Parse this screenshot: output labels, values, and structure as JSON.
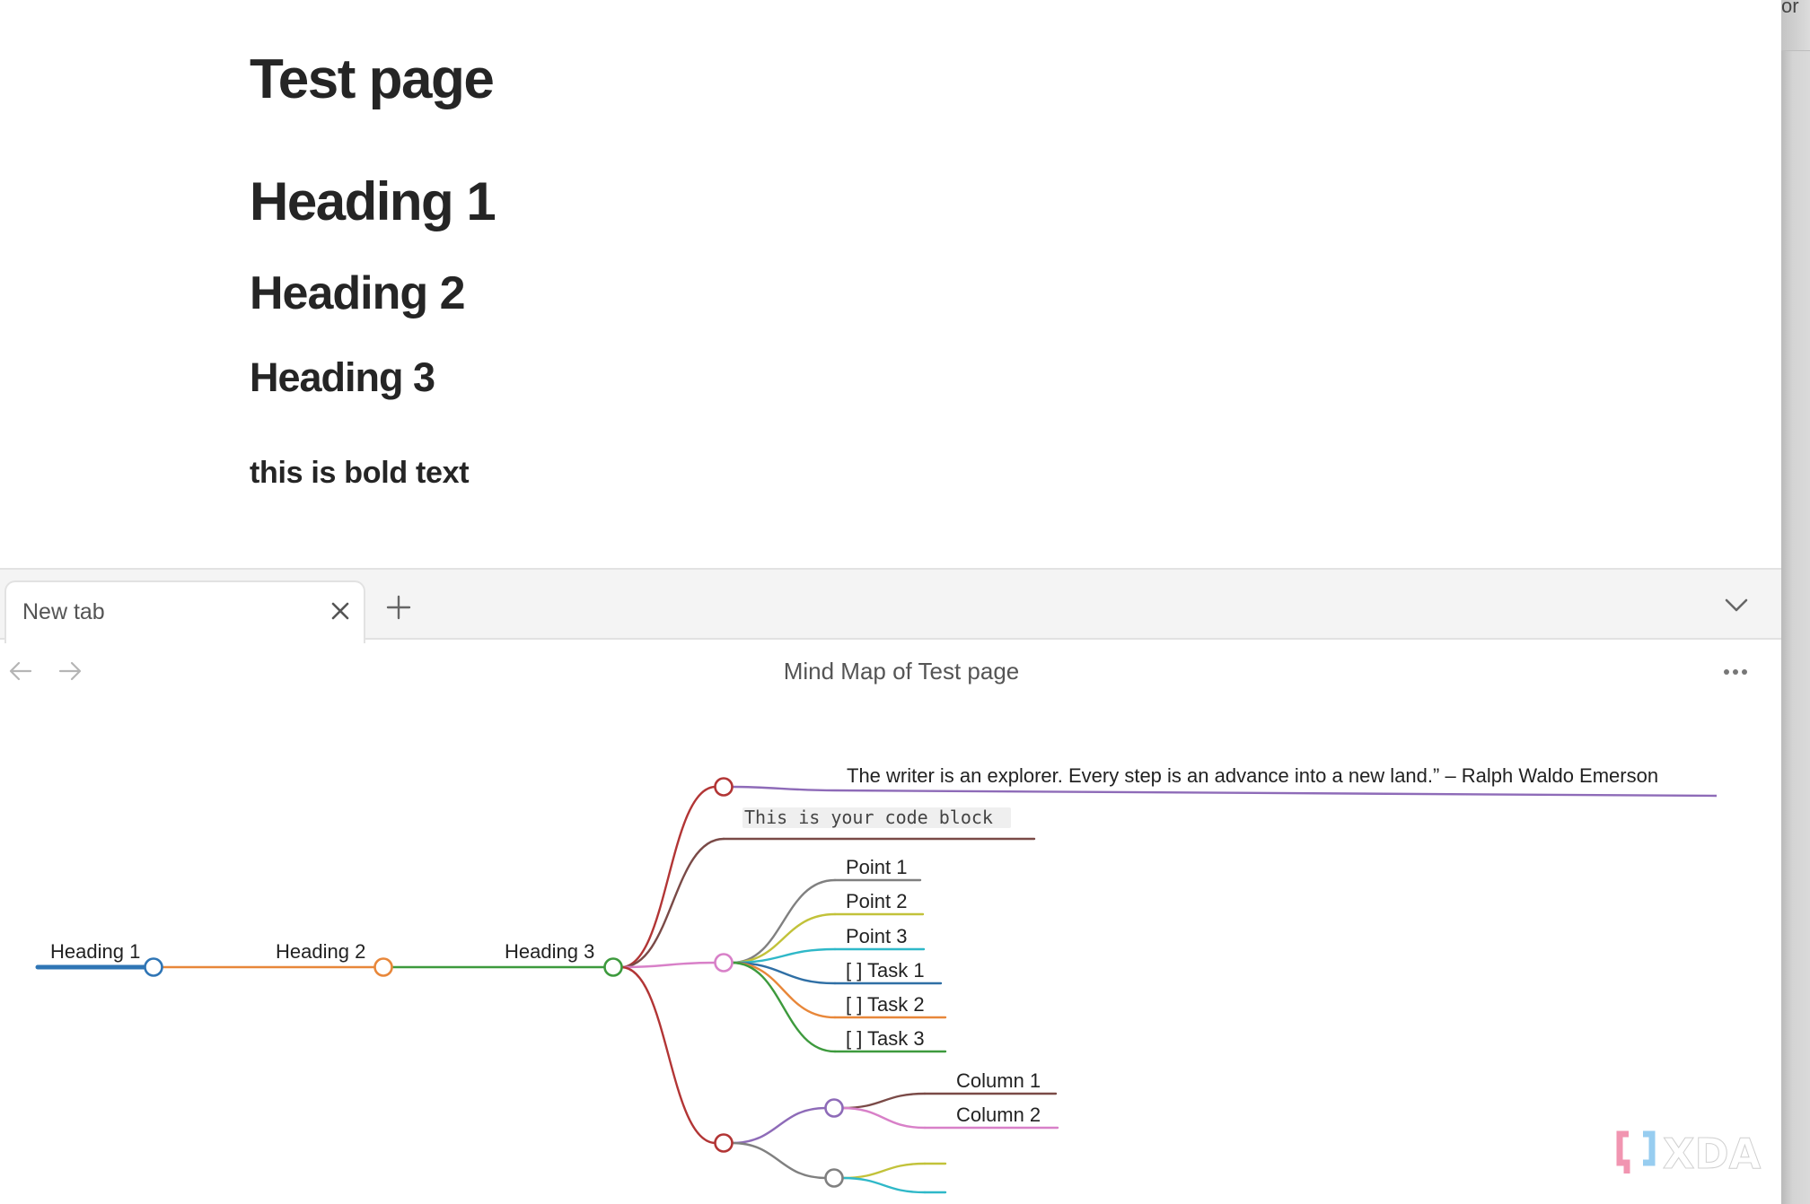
{
  "document": {
    "title": "Test page",
    "heading1": "Heading 1",
    "heading2": "Heading 2",
    "heading3": "Heading 3",
    "bold_text": "this is bold text"
  },
  "right_strip_text": "or",
  "tabbar": {
    "tabs": [
      {
        "label": "New tab",
        "active": true
      }
    ],
    "close_icon": "close-icon",
    "new_tab_icon": "plus-icon",
    "collapse_icon": "chevron-down-icon"
  },
  "panel": {
    "title": "Mind Map of Test page",
    "back_icon": "arrow-left-icon",
    "forward_icon": "arrow-right-icon",
    "more_icon": "more-horizontal-icon"
  },
  "mindmap": {
    "root": {
      "label": "Heading 1",
      "color": "#2f75b5",
      "children": [
        {
          "label": "Heading 2",
          "color": "#e8873a",
          "children": [
            {
              "label": "Heading 3",
              "color": "#3d9a3d",
              "children": [
                {
                  "label": "The writer is an explorer. Every step is an advance into a new land.” – Ralph Waldo Emerson",
                  "color": "#b23535",
                  "child_color": "#8e6bb8"
                },
                {
                  "label": "This is your code block",
                  "type": "code",
                  "color": "#7a4a47"
                },
                {
                  "label": "",
                  "color": "#d880c8",
                  "children": [
                    {
                      "label": "Point 1",
                      "color": "#808080"
                    },
                    {
                      "label": "Point 2",
                      "color": "#c2c23a"
                    },
                    {
                      "label": "Point 3",
                      "color": "#2fb8c8"
                    },
                    {
                      "label": "[ ] Task 1",
                      "color": "#2f6fa5"
                    },
                    {
                      "label": "[ ] Task 2",
                      "color": "#e8873a"
                    },
                    {
                      "label": "[ ] Task 3",
                      "color": "#3d9a3d"
                    }
                  ]
                },
                {
                  "label": "",
                  "color": "#b23535",
                  "children": [
                    {
                      "label": "",
                      "color": "#8e6bb8",
                      "children": [
                        {
                          "label": "Column 1",
                          "color": "#7a4a47"
                        },
                        {
                          "label": "Column 2",
                          "color": "#d880c8"
                        }
                      ]
                    },
                    {
                      "label": "",
                      "color": "#808080",
                      "children": [
                        {
                          "label": "",
                          "color": "#c2c23a"
                        },
                        {
                          "label": "",
                          "color": "#2fb8c8"
                        }
                      ]
                    }
                  ]
                }
              ]
            }
          ]
        }
      ]
    }
  },
  "watermark": {
    "text": "XDA",
    "bracket_left_color": "#f08aa8",
    "bracket_right_color": "#8cc8ee"
  }
}
